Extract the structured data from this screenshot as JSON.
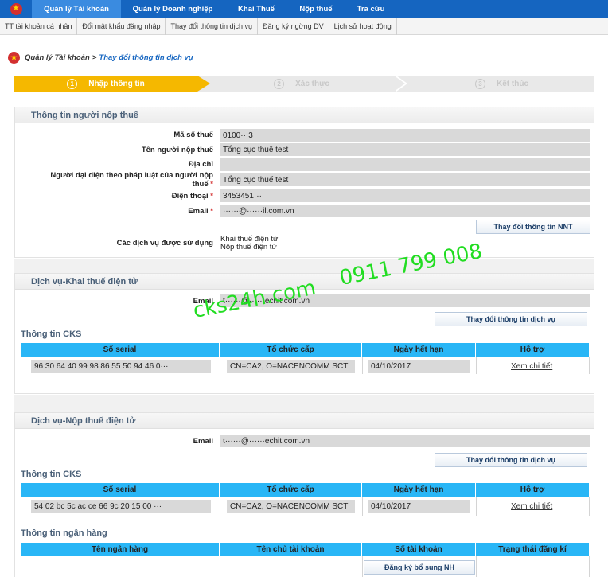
{
  "topnav": {
    "items": [
      "Quản lý Tài khoản",
      "Quản lý Doanh nghiệp",
      "Khai Thuế",
      "Nộp thuế",
      "Tra cứu"
    ]
  },
  "subnav": {
    "items": [
      "TT tài khoản cá nhân",
      "Đổi mật khẩu đăng nhập",
      "Thay đổi thông tin dịch vụ",
      "Đăng ký ngừng DV",
      "Lịch sử hoạt động"
    ]
  },
  "breadcrumb": {
    "root": "Quản lý Tài khoản",
    "sep": ">",
    "current": "Thay đổi thông tin dịch vụ"
  },
  "steps": {
    "step1": {
      "num": "1",
      "label": "Nhập thông tin"
    },
    "step2": {
      "num": "2",
      "label": "Xác thực"
    },
    "step3": {
      "num": "3",
      "label": "Kết thúc"
    }
  },
  "taxpayer": {
    "title": "Thông tin người nộp thuế",
    "mst_label": "Mã số thuế",
    "mst_value": "0100···3",
    "name_label": "Tên người nộp thuế",
    "name_value": "Tổng cục thuế test",
    "address_label": "Địa chỉ",
    "address_value": "",
    "rep_label_1": "Người đại diện theo pháp luật của người nộp",
    "rep_label_2": "thuế",
    "rep_value": "Tổng cục thuế test",
    "phone_label": "Điện thoại",
    "phone_value": "3453451···",
    "email_label": "Email",
    "email_value": "······@······il.com.vn",
    "req_mark": "*",
    "change_btn": "Thay đổi thông tin NNT",
    "services_label": "Các dịch vụ được sử dụng",
    "service_1": "Khai thuế điện tử",
    "service_2": "Nộp thuế điện tử"
  },
  "ekhai": {
    "title": "Dịch vụ-Khai thuế điện tử",
    "email_label": "Email",
    "email_value": "t······@······echit.com.vn",
    "change_btn": "Thay đổi thông tin dịch vụ",
    "cks_title": "Thông tin CKS",
    "headers": [
      "Số serial",
      "Tổ chức cấp",
      "Ngày hết hạn",
      "Hỗ trợ"
    ],
    "row": {
      "serial": "96 30 64 40 99 98 86 55 50 94 46 0···",
      "issuer": "CN=CA2, O=NACENCOMM SCT",
      "expiry": "04/10/2017",
      "link": "Xem chi tiết"
    }
  },
  "enop": {
    "title": "Dịch vụ-Nộp thuế điện tử",
    "email_label": "Email",
    "email_value": "t······@······echit.com.vn",
    "change_btn": "Thay đổi thông tin dịch vụ",
    "cks_title": "Thông tin CKS",
    "headers": [
      "Số serial",
      "Tổ chức cấp",
      "Ngày hết hạn",
      "Hỗ trợ"
    ],
    "row": {
      "serial": "54 02 bc 5c ac ce 66 9c 20 15 00 ···",
      "issuer": "CN=CA2, O=NACENCOMM SCT",
      "expiry": "04/10/2017",
      "link": "Xem chi tiết"
    },
    "bank_title": "Thông tin ngân hàng",
    "bank_headers": [
      "Tên ngân hàng",
      "Tên chủ tài khoản",
      "Số tài khoản",
      "Trạng thái đăng kí"
    ],
    "bank_btn": "Đăng ký bổ sung NH"
  },
  "watermark": {
    "site": "cks24h.com",
    "phone": "0911 799 008"
  },
  "colors": {
    "nav_blue": "#1565c0",
    "step_active": "#f5b800",
    "table_head": "#29b6f6",
    "watermark": "#22dd22"
  }
}
